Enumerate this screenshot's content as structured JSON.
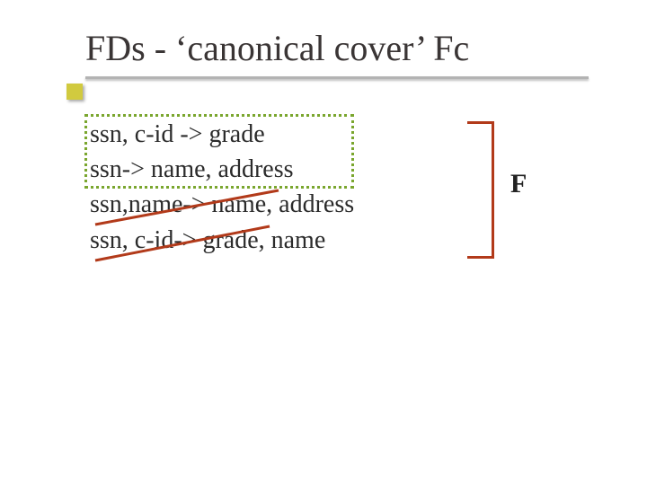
{
  "title": "FDs - ‘canonical cover’ Fc",
  "fds": {
    "line1": "ssn, c-id -> grade",
    "line2": "ssn-> name, address",
    "line3": "ssn,name-> name, address",
    "line4": "ssn, c-id-> grade, name"
  },
  "label_f": "F"
}
